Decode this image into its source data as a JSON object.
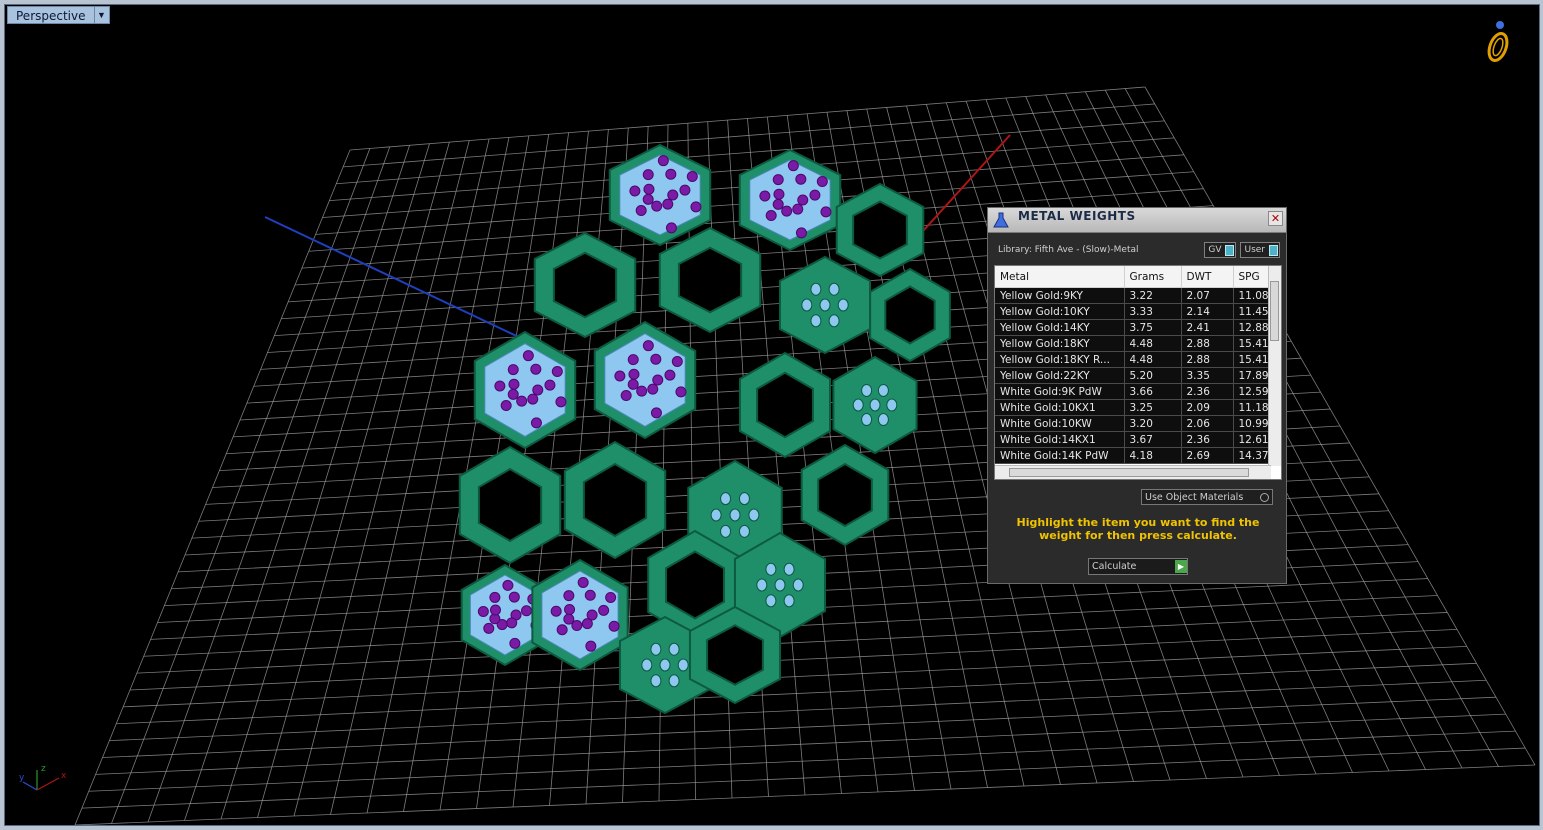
{
  "viewport": {
    "name": "Perspective"
  },
  "panel": {
    "title": "METAL WEIGHTS",
    "library": "Library: Fifth Ave - (Slow)-Metal",
    "toggle_gv": "GV",
    "toggle_user": "User",
    "columns": [
      "Metal",
      "Grams",
      "DWT",
      "SPG"
    ],
    "rows": [
      [
        "Yellow Gold:9KY",
        "3.22",
        "2.07",
        "11.08"
      ],
      [
        "Yellow Gold:10KY",
        "3.33",
        "2.14",
        "11.45"
      ],
      [
        "Yellow Gold:14KY",
        "3.75",
        "2.41",
        "12.88"
      ],
      [
        "Yellow Gold:18KY",
        "4.48",
        "2.88",
        "15.41"
      ],
      [
        "Yellow Gold:18KY R...",
        "4.48",
        "2.88",
        "15.41"
      ],
      [
        "Yellow Gold:22KY",
        "5.20",
        "3.35",
        "17.89"
      ],
      [
        "White Gold:9K PdW",
        "3.66",
        "2.36",
        "12.59"
      ],
      [
        "White Gold:10KX1",
        "3.25",
        "2.09",
        "11.18"
      ],
      [
        "White Gold:10KW",
        "3.20",
        "2.06",
        "10.99"
      ],
      [
        "White Gold:14KX1",
        "3.67",
        "2.36",
        "12.61"
      ],
      [
        "White Gold:14K PdW",
        "4.18",
        "2.69",
        "14.37"
      ]
    ],
    "use_object_materials": "Use Object Materials",
    "hint": "Highlight the item you want to find the weight for then press calculate.",
    "calculate": "Calculate"
  },
  "colors": {
    "ring": "#1f8f6a",
    "gem": "#8ec7ef",
    "prong": "#7a1aa6",
    "grid": "#9a9a9a"
  }
}
